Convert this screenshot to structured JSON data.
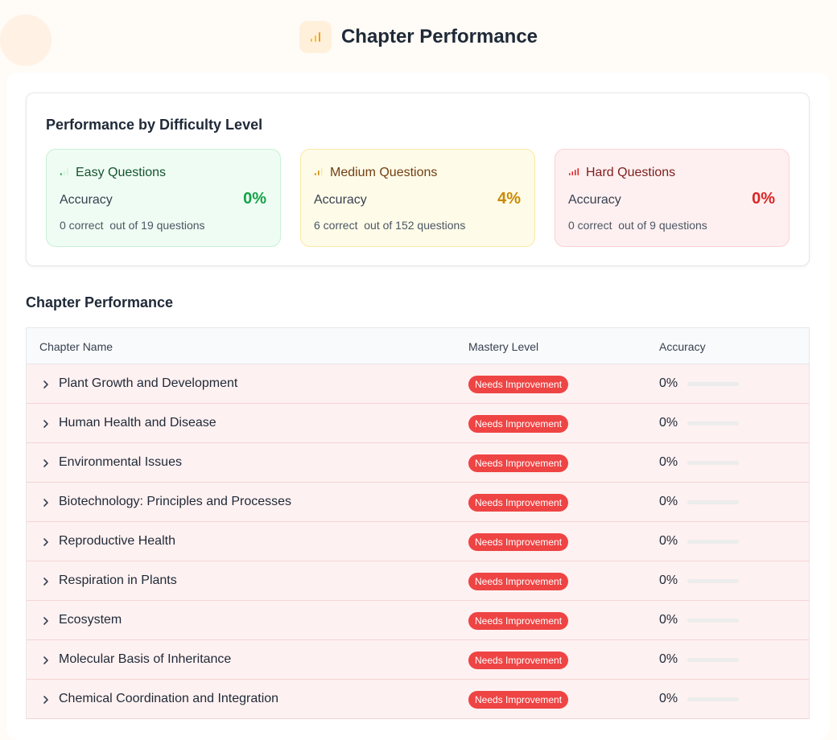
{
  "page": {
    "title": "Chapter Performance"
  },
  "difficulty": {
    "title": "Performance by Difficulty Level",
    "levels": [
      {
        "name": "Easy Questions",
        "accuracy_label": "Accuracy",
        "accuracy": "0%",
        "correct_text": "0 correct",
        "out_of_text": "out of 19 questions",
        "color": "#16a34a"
      },
      {
        "name": "Medium Questions",
        "accuracy_label": "Accuracy",
        "accuracy": "4%",
        "correct_text": "6 correct",
        "out_of_text": "out of 152 questions",
        "color": "#ca8a04"
      },
      {
        "name": "Hard Questions",
        "accuracy_label": "Accuracy",
        "accuracy": "0%",
        "correct_text": "0 correct",
        "out_of_text": "out of 9 questions",
        "color": "#dc2626"
      }
    ]
  },
  "chapters": {
    "title": "Chapter Performance",
    "columns": [
      "Chapter Name",
      "Mastery Level",
      "Accuracy"
    ],
    "badge_color": "#ef4444",
    "rows": [
      {
        "name": "Plant Growth and Development",
        "mastery": "Needs Improvement",
        "accuracy": "0%",
        "progress": 0
      },
      {
        "name": "Human Health and Disease",
        "mastery": "Needs Improvement",
        "accuracy": "0%",
        "progress": 0
      },
      {
        "name": "Environmental Issues",
        "mastery": "Needs Improvement",
        "accuracy": "0%",
        "progress": 0
      },
      {
        "name": "Biotechnology: Principles and Processes",
        "mastery": "Needs Improvement",
        "accuracy": "0%",
        "progress": 0
      },
      {
        "name": "Reproductive Health",
        "mastery": "Needs Improvement",
        "accuracy": "0%",
        "progress": 0
      },
      {
        "name": "Respiration in Plants",
        "mastery": "Needs Improvement",
        "accuracy": "0%",
        "progress": 0
      },
      {
        "name": "Ecosystem",
        "mastery": "Needs Improvement",
        "accuracy": "0%",
        "progress": 0
      },
      {
        "name": "Molecular Basis of Inheritance",
        "mastery": "Needs Improvement",
        "accuracy": "0%",
        "progress": 0
      },
      {
        "name": "Chemical Coordination and Integration",
        "mastery": "Needs Improvement",
        "accuracy": "0%",
        "progress": 0
      }
    ]
  }
}
